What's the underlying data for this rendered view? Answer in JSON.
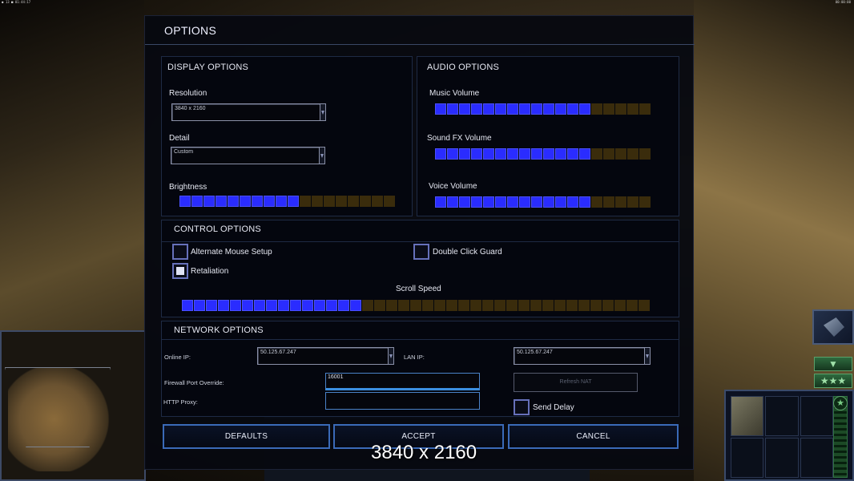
{
  "top_status": {
    "left": "● 13 ■ 01:44:17",
    "right": "00:00:00"
  },
  "dialog": {
    "title": "OPTIONS",
    "display": {
      "title": "DISPLAY OPTIONS",
      "resolution_label": "Resolution",
      "resolution_value": "3840 x 2160",
      "detail_label": "Detail",
      "detail_value": "Custom",
      "brightness_label": "Brightness",
      "brightness_level": 0.55
    },
    "audio": {
      "title": "AUDIO OPTIONS",
      "music_label": "Music Volume",
      "music_level": 0.73,
      "sfx_label": "Sound FX Volume",
      "sfx_level": 0.73,
      "voice_label": "Voice Volume",
      "voice_level": 0.73
    },
    "control": {
      "title": "CONTROL OPTIONS",
      "alt_mouse_label": "Alternate Mouse Setup",
      "alt_mouse_checked": false,
      "double_click_label": "Double Click Guard",
      "double_click_checked": false,
      "retaliation_label": "Retaliation",
      "retaliation_checked": true,
      "scroll_label": "Scroll Speed",
      "scroll_level": 0.39
    },
    "network": {
      "title": "NETWORK OPTIONS",
      "online_ip_label": "Online IP:",
      "online_ip_value": "50.125.67.247",
      "lan_ip_label": "LAN IP:",
      "lan_ip_value": "50.125.67.247",
      "firewall_label": "Firewall Port Override:",
      "firewall_value": "16001",
      "proxy_label": "HTTP Proxy:",
      "proxy_value": "",
      "refresh_nat_label": "Refresh NAT",
      "send_delay_label": "Send Delay",
      "send_delay_checked": false
    },
    "buttons": {
      "defaults": "DEFAULTS",
      "accept": "ACCEPT",
      "cancel": "CANCEL"
    }
  },
  "status_message": "3840 x 2160",
  "icons": {
    "dropdown": "chevron-down-icon",
    "hud_up": "chevron-down-icon",
    "hud_rank": "★★★",
    "hud_badge": "★"
  }
}
